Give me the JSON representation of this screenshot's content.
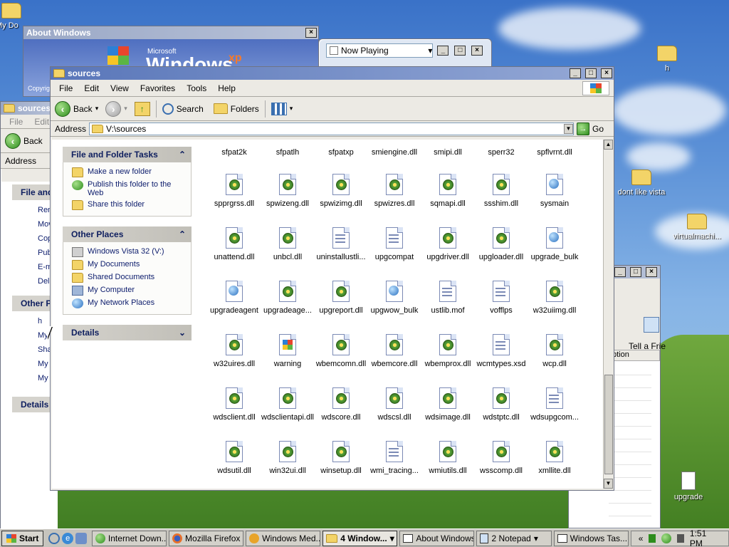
{
  "desktop": {
    "icons": [
      {
        "label": "h"
      },
      {
        "label": "dont like vista"
      },
      {
        "label": "virtualmachi..."
      },
      {
        "label": "upgrade"
      },
      {
        "label": "My Do"
      }
    ]
  },
  "about_window": {
    "title": "About Windows",
    "brand": "Windows",
    "brand_sup": "xp",
    "brand_small": "Microsoft",
    "copy": "Copyright © Microso"
  },
  "now_playing": {
    "title": "Now Playing"
  },
  "back_window": {
    "title": "sources",
    "menu": [
      "File",
      "Edit"
    ],
    "back": "Back",
    "address": "Address",
    "tasks": [
      "Ren",
      "Mov",
      "Cop",
      "Pub",
      "E-m",
      "Del"
    ],
    "other": [
      "h",
      "My",
      "Sha",
      "My",
      "My"
    ],
    "heads": [
      "File and",
      "Other P",
      "Details"
    ]
  },
  "right_window": {
    "caption": "Tell a Frie",
    "col": "ption"
  },
  "explorer": {
    "title": "sources",
    "menu": [
      "File",
      "Edit",
      "View",
      "Favorites",
      "Tools",
      "Help"
    ],
    "toolbar": {
      "back": "Back",
      "search": "Search",
      "folders": "Folders"
    },
    "address": {
      "label": "Address",
      "value": "V:\\sources",
      "go": "Go"
    },
    "file_tasks": {
      "title": "File and Folder Tasks",
      "items": [
        "Make a new folder",
        "Publish this folder to the Web",
        "Share this folder"
      ]
    },
    "other_places": {
      "title": "Other Places",
      "items": [
        "Windows Vista 32 (V:)",
        "My Documents",
        "Shared Documents",
        "My Computer",
        "My Network Places"
      ]
    },
    "details": {
      "title": "Details"
    },
    "top_row": [
      "sfpat2k",
      "sfpatlh",
      "sfpatxp",
      "smiengine.dll",
      "smipi.dll",
      "sperr32",
      "spflvrnt.dll"
    ],
    "files": [
      [
        "spprgrss.dll",
        "spwizeng.dll",
        "spwizimg.dll",
        "spwizres.dll",
        "sqmapi.dll",
        "ssshim.dll",
        "sysmain"
      ],
      [
        "unattend.dll",
        "unbcl.dll",
        "uninstallustli...",
        "upgcompat",
        "upgdriver.dll",
        "upgloader.dll",
        "upgrade_bulk"
      ],
      [
        "upgradeagent",
        "upgradeage...",
        "upgreport.dll",
        "upgwow_bulk",
        "ustlib.mof",
        "vofflps",
        "w32uiimg.dll"
      ],
      [
        "w32uires.dll",
        "warning",
        "wbemcomn.dll",
        "wbemcore.dll",
        "wbemprox.dll",
        "wcmtypes.xsd",
        "wcp.dll"
      ],
      [
        "wdsclient.dll",
        "wdsclientapi.dll",
        "wdscore.dll",
        "wdscsl.dll",
        "wdsimage.dll",
        "wdstptc.dll",
        "wdsupgcom..."
      ],
      [
        "wdsutil.dll",
        "win32ui.dll",
        "winsetup.dll",
        "wmi_tracing...",
        "wmiutils.dll",
        "wsscomp.dll",
        "xmllite.dll"
      ]
    ]
  },
  "taskbar": {
    "start": "Start",
    "items": [
      "Internet Down...",
      "Mozilla Firefox ...",
      "Windows Med...",
      "4 Window...",
      "About Windows",
      "2 Notepad",
      "Windows Tas..."
    ],
    "clock": "1:51 PM"
  }
}
